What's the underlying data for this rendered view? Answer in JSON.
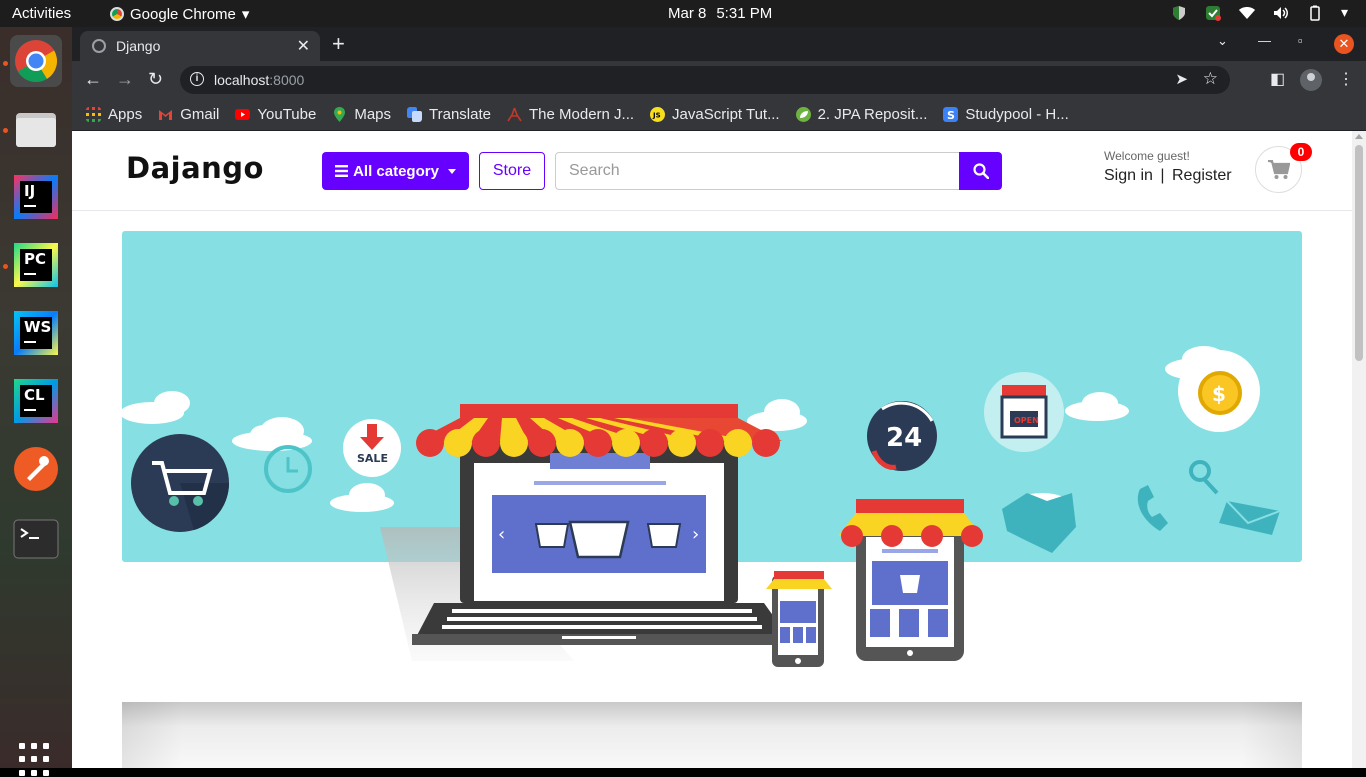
{
  "system": {
    "activities": "Activities",
    "app_name": "Google Chrome",
    "date": "Mar 8",
    "time": "5:31 PM"
  },
  "browser": {
    "tab_title": "Django",
    "url_host": "localhost",
    "url_port": ":8000",
    "bookmarks": [
      {
        "label": "Apps",
        "icon": "apps-grid-icon",
        "color": "#4285f4"
      },
      {
        "label": "Gmail",
        "icon": "gmail-icon",
        "color": "#ea4335"
      },
      {
        "label": "YouTube",
        "icon": "youtube-icon",
        "color": "#ff0000"
      },
      {
        "label": "Maps",
        "icon": "maps-pin-icon",
        "color": "#34a853"
      },
      {
        "label": "Translate",
        "icon": "translate-icon",
        "color": "#4285f4"
      },
      {
        "label": "The Modern J...",
        "icon": "modern-js-icon",
        "color": "#c0392b"
      },
      {
        "label": "JavaScript Tut...",
        "icon": "js-icon",
        "color": "#f7df1e"
      },
      {
        "label": "2. JPA Reposit...",
        "icon": "spring-leaf-icon",
        "color": "#6db33f"
      },
      {
        "label": "Studypool - H...",
        "icon": "studypool-icon",
        "color": "#3b82f6"
      }
    ]
  },
  "site": {
    "logo": "Dajango",
    "category_button": "All category",
    "store_button": "Store",
    "search_placeholder": "Search",
    "welcome": "Welcome guest!",
    "sign_in": "Sign in",
    "separator": "|",
    "register": "Register",
    "cart_count": "0",
    "accent_color": "#6600ff"
  },
  "banner": {
    "sale_text": "SALE",
    "clock_text": "24",
    "open_sign": "OPEN"
  }
}
